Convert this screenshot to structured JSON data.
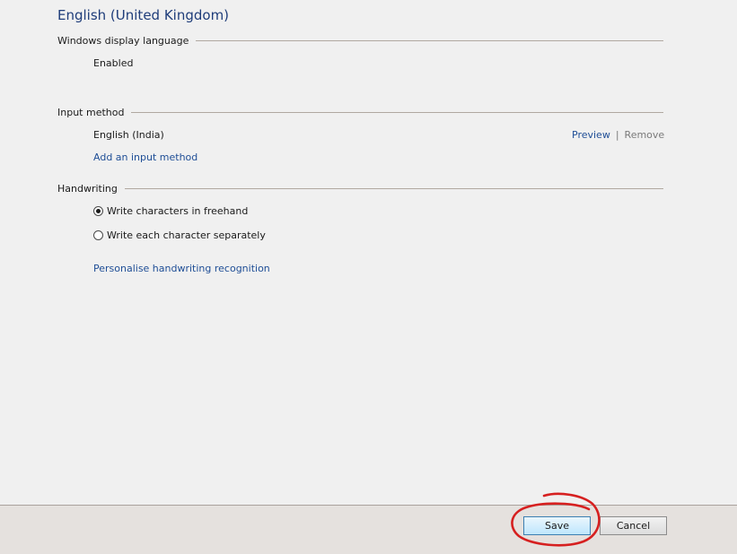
{
  "page": {
    "title": "English (United Kingdom)"
  },
  "display_language": {
    "header": "Windows display language",
    "status": "Enabled"
  },
  "input_method": {
    "header": "Input method",
    "items": [
      {
        "name": "English (India)",
        "preview_label": "Preview",
        "separator": "|",
        "remove_label": "Remove"
      }
    ],
    "add_label": "Add an input method"
  },
  "handwriting": {
    "header": "Handwriting",
    "options": [
      {
        "label": "Write characters in freehand",
        "selected": true
      },
      {
        "label": "Write each character separately",
        "selected": false
      }
    ],
    "personalise_label": "Personalise handwriting recognition"
  },
  "footer": {
    "save_label": "Save",
    "cancel_label": "Cancel"
  },
  "colors": {
    "title": "#1f3d7a",
    "link": "#1f4e96",
    "disabled_link": "#7a7a7a",
    "annotation_circle": "#d62020"
  },
  "icons": {
    "radio_checked": "radio-checked-icon",
    "radio_unchecked": "radio-unchecked-icon"
  }
}
